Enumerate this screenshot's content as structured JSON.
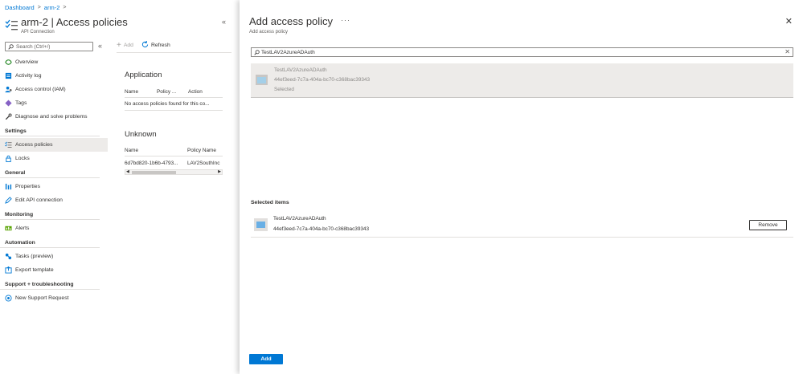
{
  "breadcrumb": [
    "Dashboard",
    "arm-2"
  ],
  "resource": {
    "title": "arm-2 | Access policies",
    "subtitle": "API Connection"
  },
  "nav_search_placeholder": "Search (Ctrl+/)",
  "nav": {
    "top": [
      {
        "label": "Overview",
        "icon": "overview-icon"
      },
      {
        "label": "Activity log",
        "icon": "activity-log-icon"
      },
      {
        "label": "Access control (IAM)",
        "icon": "iam-icon"
      },
      {
        "label": "Tags",
        "icon": "tag-icon"
      },
      {
        "label": "Diagnose and solve problems",
        "icon": "wrench-icon"
      }
    ],
    "sections": [
      {
        "title": "Settings",
        "items": [
          {
            "label": "Access policies",
            "icon": "list-icon",
            "active": true
          },
          {
            "label": "Locks",
            "icon": "lock-icon"
          }
        ]
      },
      {
        "title": "General",
        "items": [
          {
            "label": "Properties",
            "icon": "properties-icon"
          },
          {
            "label": "Edit API connection",
            "icon": "pencil-icon"
          }
        ]
      },
      {
        "title": "Monitoring",
        "items": [
          {
            "label": "Alerts",
            "icon": "alerts-icon"
          }
        ]
      },
      {
        "title": "Automation",
        "items": [
          {
            "label": "Tasks (preview)",
            "icon": "tasks-icon"
          },
          {
            "label": "Export template",
            "icon": "export-icon"
          }
        ]
      },
      {
        "title": "Support + troubleshooting",
        "items": [
          {
            "label": "New Support Request",
            "icon": "support-icon"
          }
        ]
      }
    ]
  },
  "toolbar": {
    "add_label": "Add",
    "refresh_label": "Refresh"
  },
  "application": {
    "title": "Application",
    "columns": [
      "Name",
      "Policy ...",
      "Action"
    ],
    "empty_text": "No access policies found for this co..."
  },
  "unknown": {
    "title": "Unknown",
    "columns": [
      "Name",
      "Policy Name"
    ],
    "rows": [
      [
        "6d7bd820-1b6b-4793...",
        "LAV2SouthInc"
      ]
    ]
  },
  "panel": {
    "title": "Add access policy",
    "subtitle": "Add access policy",
    "search_value": "TestLAV2AzureADAuth",
    "result": {
      "name": "TestLAV2AzureADAuth",
      "object_id": "44ef3eed-7c7a-404a-bc70-c368bac39343",
      "state": "Selected"
    },
    "selected_title": "Selected items",
    "selected": [
      {
        "name": "TestLAV2AzureADAuth",
        "object_id": "44ef3eed-7c7a-404a-bc70-c368bac39343"
      }
    ],
    "remove_label": "Remove",
    "add_label": "Add"
  },
  "colors": {
    "accent": "#0078d4",
    "selected_bg": "#edebe9"
  }
}
